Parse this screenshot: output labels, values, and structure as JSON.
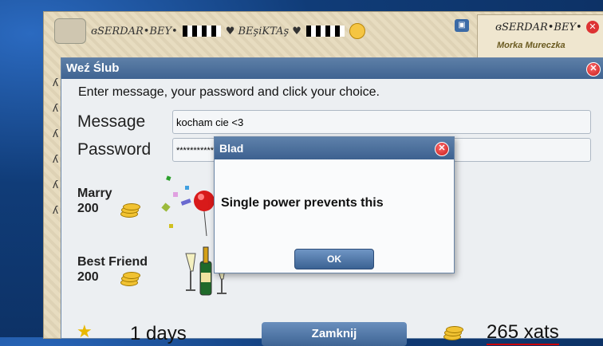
{
  "chat": {
    "name": "ɞSERDAR•BEY•",
    "tag": "♥ BEşiKTAş ♥",
    "right_name": "ɞSERDAR•BEY•",
    "right_sub": "Mureczka",
    "right_logo": "Morka"
  },
  "dialog": {
    "title": "Weź Ślub",
    "close_symbol": "✕",
    "instructions": "Enter message, your password and click your choice.",
    "message_label": "Message",
    "message_value": "kocham cie <3",
    "password_label": "Password",
    "password_value": "*************",
    "marry_label": "Marry",
    "marry_price": "200",
    "bestfriend_label": "Best Friend",
    "bestfriend_price": "200",
    "days_text": "1 days",
    "close_button": "Zamknij",
    "xats_text": "265 xats"
  },
  "error": {
    "title": "Blad",
    "close_symbol": "✕",
    "message": "Single power prevents this",
    "ok_button": "OK"
  },
  "colors": {
    "title_bar": "#3f6391",
    "close_red": "#c51b1b",
    "star": "#e8b800"
  }
}
